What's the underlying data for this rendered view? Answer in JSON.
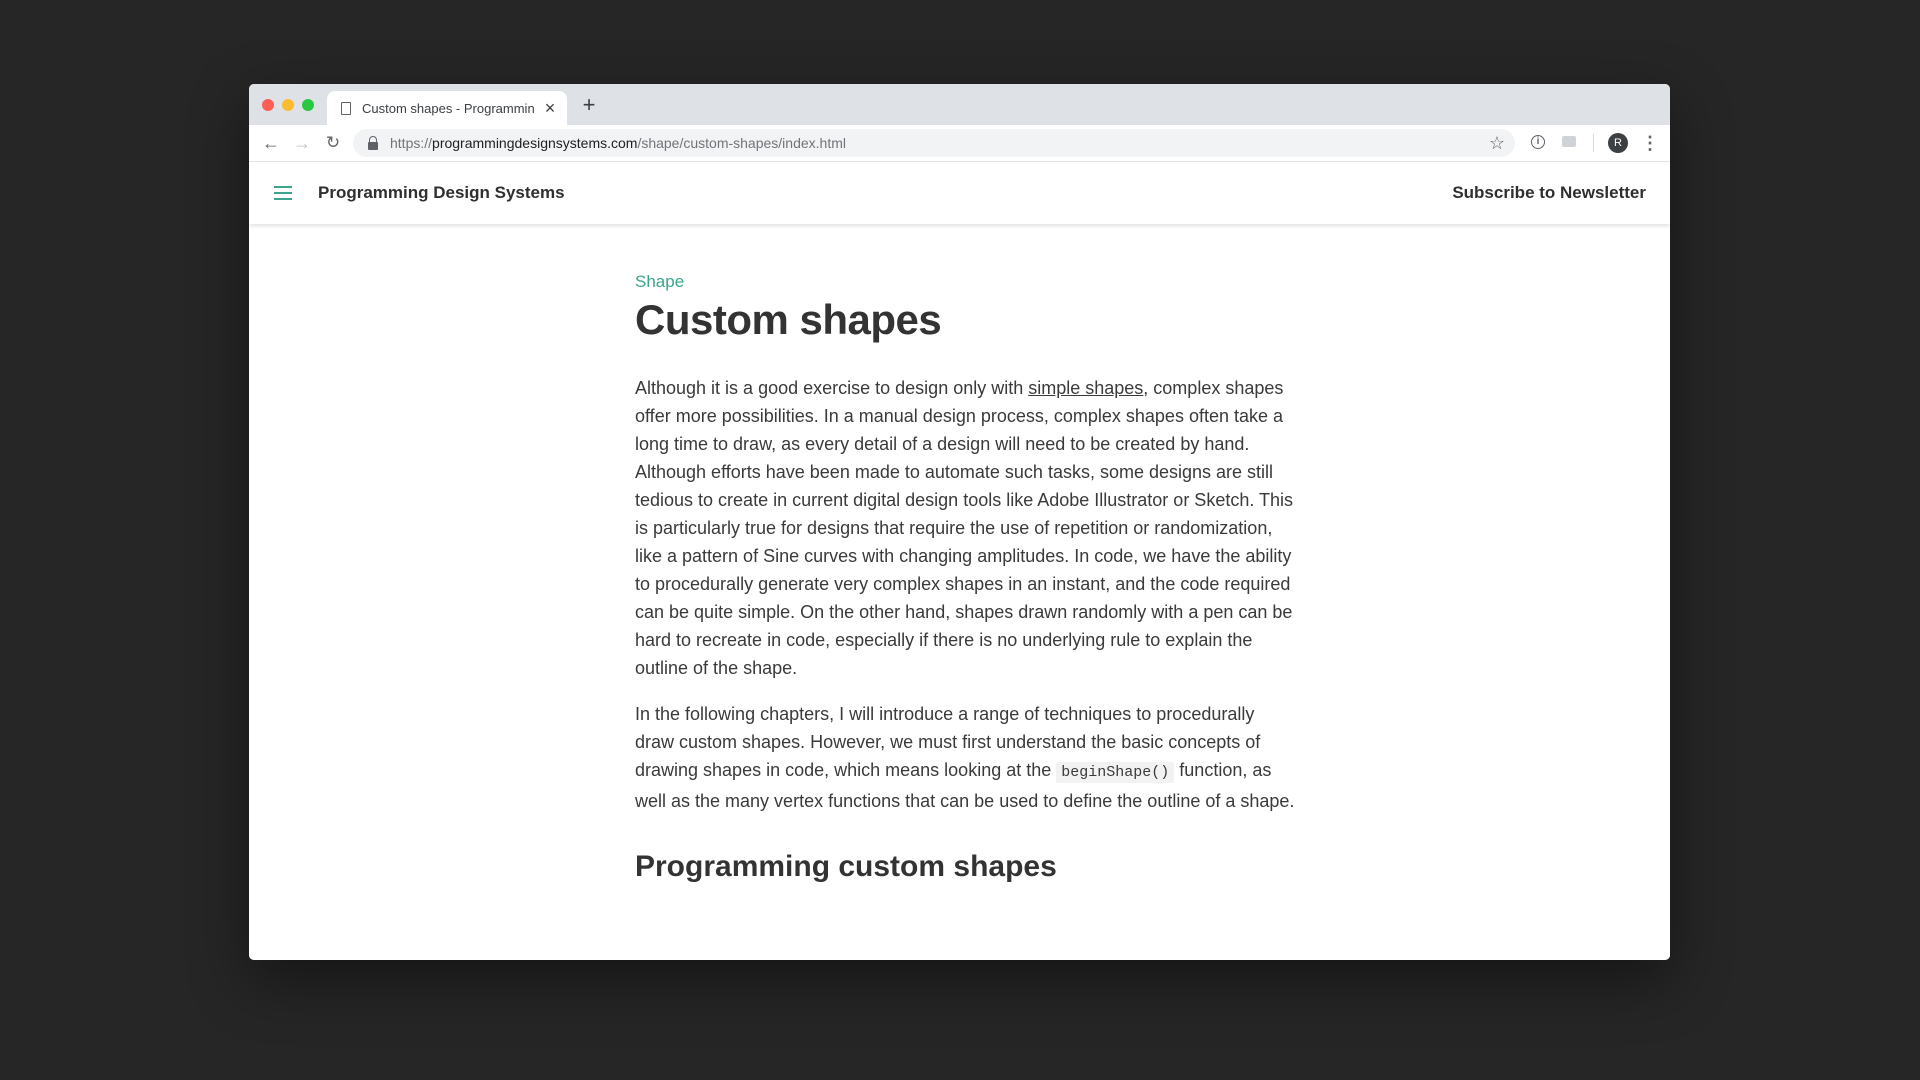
{
  "browser": {
    "tab_title": "Custom shapes - Programming Design Systems",
    "tab_close": "×",
    "new_tab": "+",
    "url_scheme": "https://",
    "url_host": "programmingdesignsystems.com",
    "url_path": "/shape/custom-shapes/index.html",
    "avatar_initial": "R",
    "back_glyph": "←",
    "forward_glyph": "→",
    "reload_glyph": "↻",
    "star_glyph": "☆",
    "info_glyph": "i",
    "menu_glyph": "⋮"
  },
  "site": {
    "title": "Programming Design Systems",
    "subscribe": "Subscribe to Newsletter"
  },
  "article": {
    "section": "Shape",
    "title": "Custom shapes",
    "p1_before_link": "Although it is a good exercise to design only with ",
    "p1_link": "simple shapes",
    "p1_after_link": ", complex shapes offer more possibilities. In a manual design process, complex shapes often take a long time to draw, as every detail of a design will need to be created by hand. Although efforts have been made to automate such tasks, some designs are still tedious to create in current digital design tools like Adobe Illustrator or Sketch. This is particularly true for designs that require the use of repetition or randomization, like a pattern of Sine curves with changing amplitudes. In code, we have the ability to procedurally generate very complex shapes in an instant, and the code required can be quite simple. On the other hand, shapes drawn randomly with a pen can be hard to recreate in code, especially if there is no underlying rule to explain the outline of the shape.",
    "p2_before_code": "In the following chapters, I will introduce a range of techniques to procedurally draw custom shapes. However, we must first understand the basic concepts of drawing shapes in code, which means looking at the ",
    "p2_code": "beginShape()",
    "p2_after_code": " function, as well as the many vertex functions that can be used to define the outline of a shape.",
    "h2": "Programming custom shapes"
  },
  "colors": {
    "accent": "#3aa58c",
    "background": "#262626"
  }
}
